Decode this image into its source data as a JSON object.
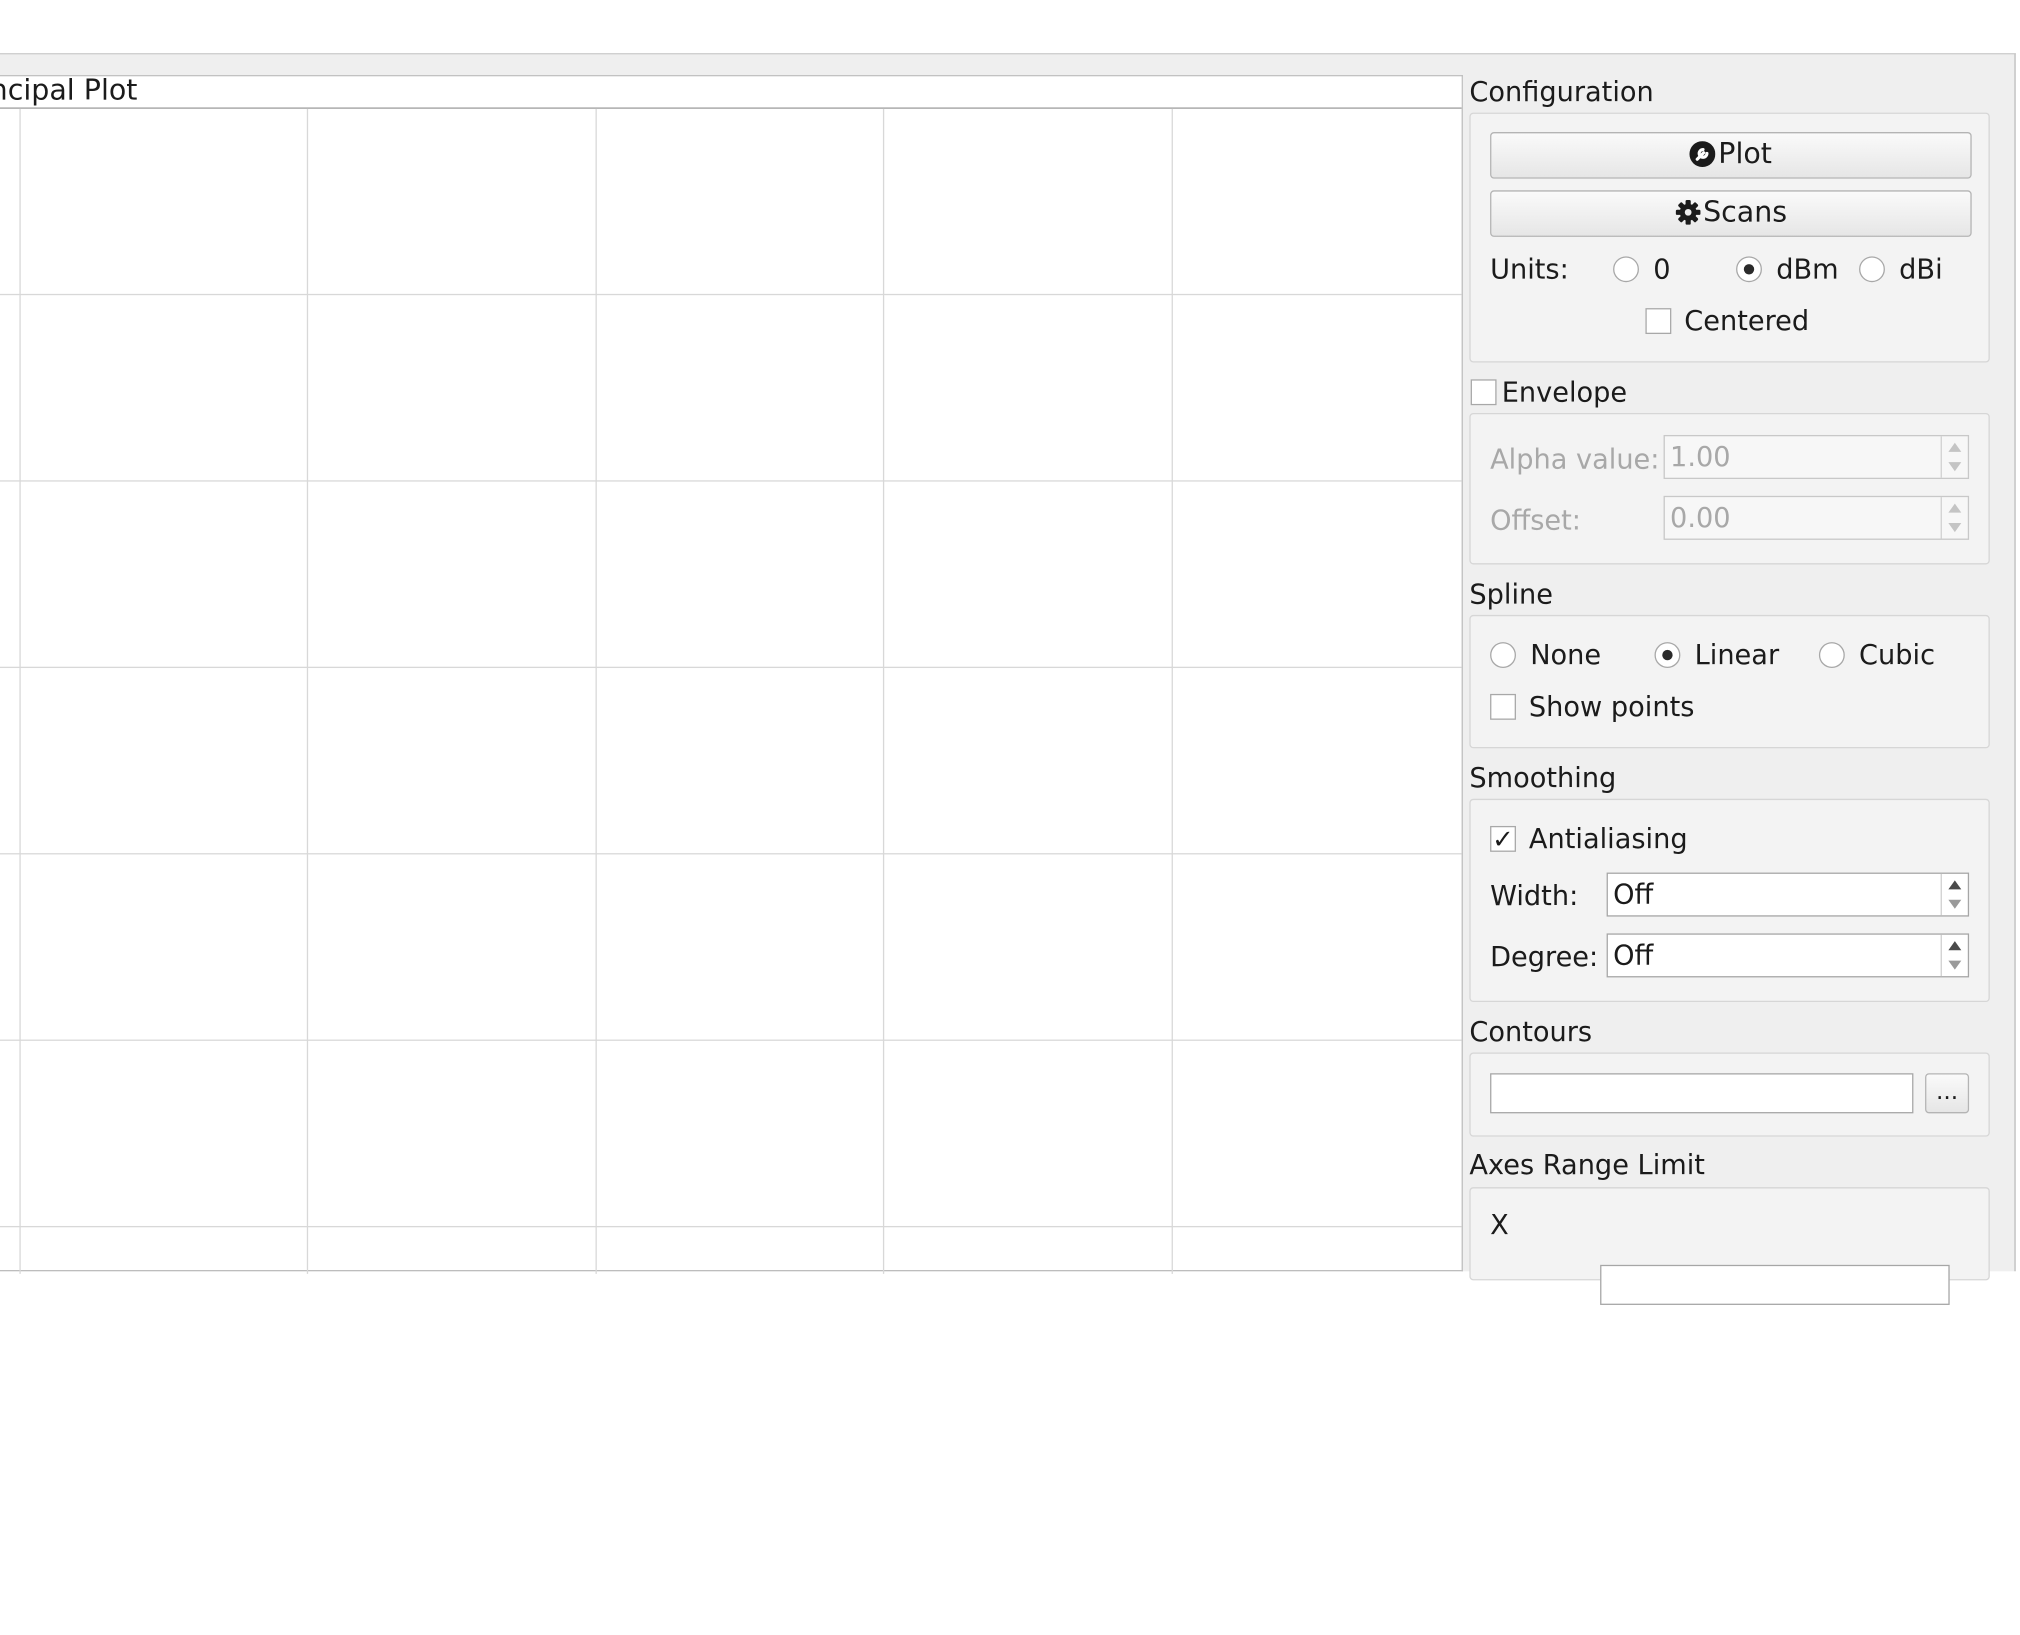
{
  "plot": {
    "title": "ncipal Plot"
  },
  "configuration": {
    "title": "Configuration",
    "plot_button": "Plot",
    "scans_button": "Scans",
    "units_label": "Units:",
    "units_options": [
      "0",
      "dBm",
      "dBi"
    ],
    "units_selected": "dBm",
    "centered_label": "Centered",
    "centered_checked": false
  },
  "envelope": {
    "label": "Envelope",
    "checked": false,
    "alpha_label": "Alpha value:",
    "alpha_value": "1.00",
    "offset_label": "Offset:",
    "offset_value": "0.00"
  },
  "spline": {
    "title": "Spline",
    "options": [
      "None",
      "Linear",
      "Cubic"
    ],
    "selected": "Linear",
    "show_points_label": "Show points",
    "show_points_checked": false
  },
  "smoothing": {
    "title": "Smoothing",
    "antialiasing_label": "Antialiasing",
    "antialiasing_checked": true,
    "check_mark": "✓",
    "width_label": "Width:",
    "width_value": "Off",
    "degree_label": "Degree:",
    "degree_value": "Off"
  },
  "contours": {
    "title": "Contours",
    "path_value": "",
    "browse_button": "..."
  },
  "axes_range": {
    "title": "Axes Range Limit",
    "x_label": "X"
  },
  "icons": {
    "plot_button_icon": "wrench-icon",
    "scans_button_icon": "gear-icon"
  }
}
